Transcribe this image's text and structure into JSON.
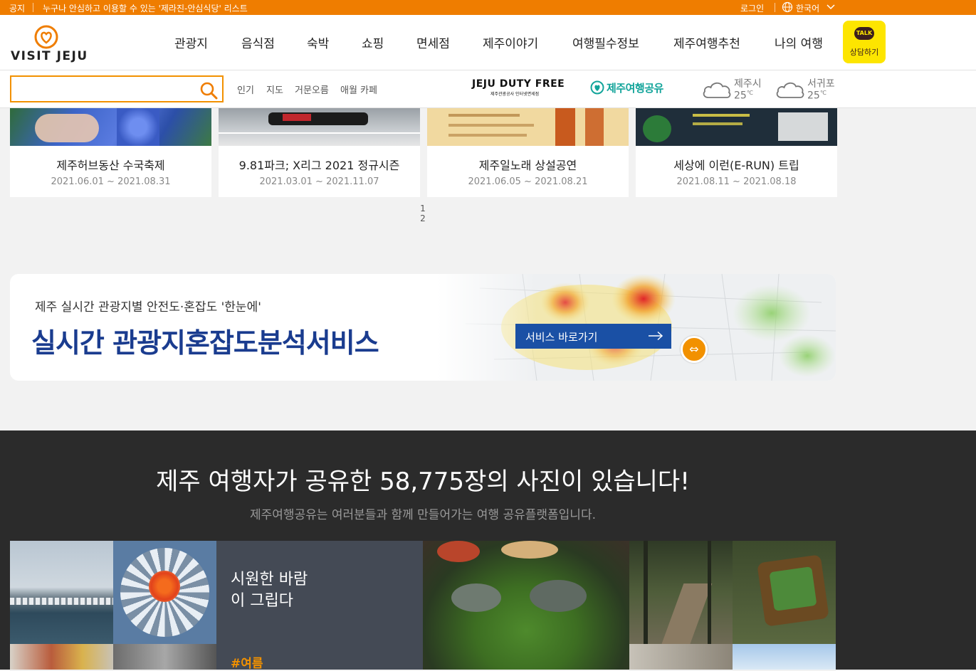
{
  "topbar": {
    "notice_tag": "공지",
    "notice_text": "누구나 안심하고 이용할 수 있는 '제라진-안심식당' 리스트",
    "login": "로그인",
    "language": "한국어"
  },
  "header": {
    "logo_text": "VISIT JEJU",
    "nav": [
      "관광지",
      "음식점",
      "숙박",
      "쇼핑",
      "면세점",
      "제주이야기",
      "여행필수정보",
      "제주여행추천",
      "나의 여행"
    ],
    "talk_bubble": "TALK",
    "talk_label": "상담하기"
  },
  "search": {
    "value": "",
    "placeholder": "",
    "keywords": [
      "인기",
      "지도",
      "거문오름",
      "애월 카페"
    ],
    "dutyfree_title": "JEJU DUTY FREE",
    "dutyfree_sub": "제주관광공사 인터넷면세점",
    "share_label": "제주여행공유",
    "weather": [
      {
        "city": "제주시",
        "temp": "25",
        "unit": "℃"
      },
      {
        "city": "서귀포",
        "temp": "25",
        "unit": "℃"
      }
    ]
  },
  "events": [
    {
      "title": "제주허브동산 수국축제",
      "date": "2021.06.01 ~ 2021.08.31"
    },
    {
      "title": "9.81파크; X리그 2021 정규시즌",
      "date": "2021.03.01 ~ 2021.11.07"
    },
    {
      "title": "제주일노래 상설공연",
      "date": "2021.06.05 ~ 2021.08.21"
    },
    {
      "title": "세상에 이런(E-RUN) 트립",
      "date": "2021.08.11 ~ 2021.08.18"
    }
  ],
  "pager": [
    "1",
    "2"
  ],
  "banner": {
    "subtitle": "제주 실시간 관광지별 안전도·혼잡도 '한눈에'",
    "title": "실시간 관광지혼잡도분석서비스",
    "button": "서비스 바로가기",
    "handle": "⇔"
  },
  "share_section": {
    "headline": "제주 여행자가 공유한 58,775장의 사진이 있습니다!",
    "description": "제주여행공유는 여러분들과 함께 만들어가는 여행 공유플랫폼입니다.",
    "feature_title": "시원한 바람이 그립다",
    "feature_tag": "#여름"
  },
  "colors": {
    "accent": "#ef7d00",
    "banner_title": "#1a3c8f",
    "button_blue": "#1a50a5",
    "dark_bg": "#2b2b2b",
    "talk_yellow": "#fde500"
  }
}
